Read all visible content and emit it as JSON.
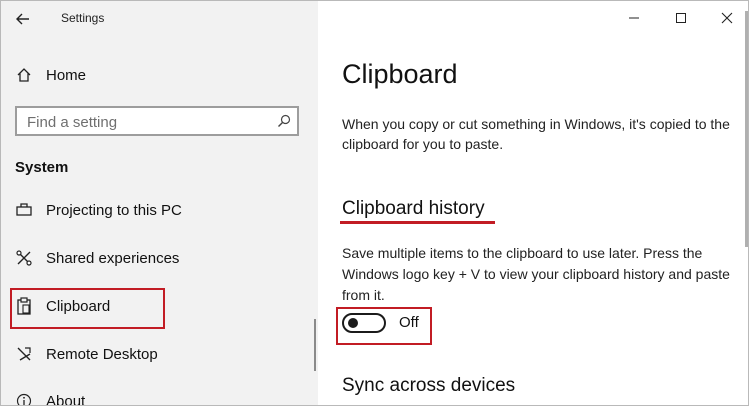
{
  "window": {
    "title": "Settings",
    "minimize_icon": "minimize-icon",
    "maximize_icon": "maximize-icon",
    "close_icon": "close-icon"
  },
  "sidebar": {
    "home": {
      "label": "Home",
      "icon": "home-icon"
    },
    "search": {
      "placeholder": "Find a setting",
      "icon": "search-icon"
    },
    "section": "System",
    "items": [
      {
        "label": "Projecting to this PC",
        "icon": "projector-icon"
      },
      {
        "label": "Shared experiences",
        "icon": "shared-experiences-icon"
      },
      {
        "label": "Clipboard",
        "icon": "clipboard-icon",
        "selected": true
      },
      {
        "label": "Remote Desktop",
        "icon": "remote-desktop-icon"
      },
      {
        "label": "About",
        "icon": "info-icon"
      }
    ]
  },
  "main": {
    "title": "Clipboard",
    "description": "When you copy or cut something in Windows, it's copied to the clipboard for you to paste.",
    "history": {
      "title": "Clipboard history",
      "description": "Save multiple items to the clipboard to use later. Press the Windows logo key + V to view your clipboard history and paste from it.",
      "toggle_state": "Off"
    },
    "sync_title": "Sync across devices"
  },
  "colors": {
    "highlight": "#c21c24",
    "sidebar_bg": "#f2f2f2"
  }
}
